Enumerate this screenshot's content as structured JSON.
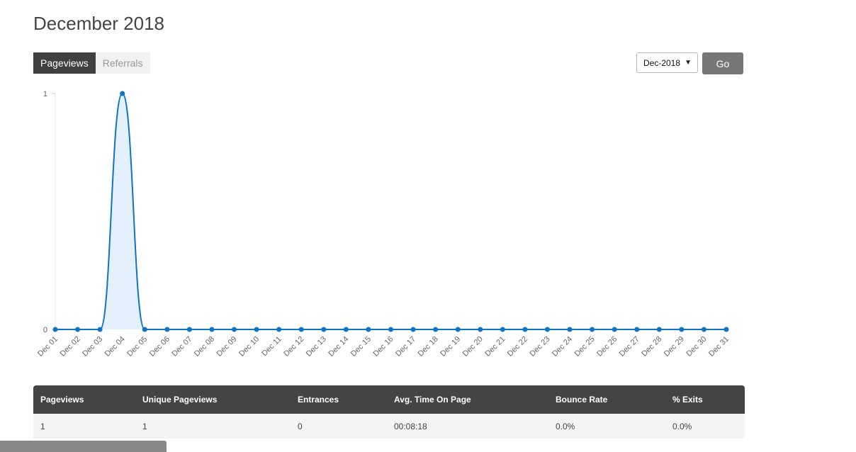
{
  "page": {
    "title": "December 2018"
  },
  "tabs": [
    {
      "label": "Pageviews",
      "active": true
    },
    {
      "label": "Referrals",
      "active": false
    }
  ],
  "controls": {
    "period_selected": "Dec-2018",
    "go_label": "Go"
  },
  "chart_data": {
    "type": "area",
    "title": "",
    "xlabel": "",
    "ylabel": "",
    "ylim": [
      0,
      1
    ],
    "y_ticks": [
      "0",
      "1"
    ],
    "categories": [
      "Dec 01",
      "Dec 02",
      "Dec 03",
      "Dec 04",
      "Dec 05",
      "Dec 06",
      "Dec 07",
      "Dec 08",
      "Dec 09",
      "Dec 10",
      "Dec 11",
      "Dec 12",
      "Dec 13",
      "Dec 14",
      "Dec 15",
      "Dec 16",
      "Dec 17",
      "Dec 18",
      "Dec 19",
      "Dec 20",
      "Dec 21",
      "Dec 22",
      "Dec 23",
      "Dec 24",
      "Dec 25",
      "Dec 26",
      "Dec 27",
      "Dec 28",
      "Dec 29",
      "Dec 30",
      "Dec 31"
    ],
    "values": [
      0,
      0,
      0,
      1,
      0,
      0,
      0,
      0,
      0,
      0,
      0,
      0,
      0,
      0,
      0,
      0,
      0,
      0,
      0,
      0,
      0,
      0,
      0,
      0,
      0,
      0,
      0,
      0,
      0,
      0,
      0
    ],
    "grid": false,
    "legend": "none",
    "line_color": "#0f74c4",
    "fill_color": "#e4f0fb"
  },
  "stats": {
    "headers": [
      "Pageviews",
      "Unique Pageviews",
      "Entrances",
      "Avg. Time On Page",
      "Bounce Rate",
      "% Exits"
    ],
    "rows": [
      [
        "1",
        "1",
        "0",
        "00:08:18",
        "0.0%",
        "0.0%"
      ]
    ]
  }
}
